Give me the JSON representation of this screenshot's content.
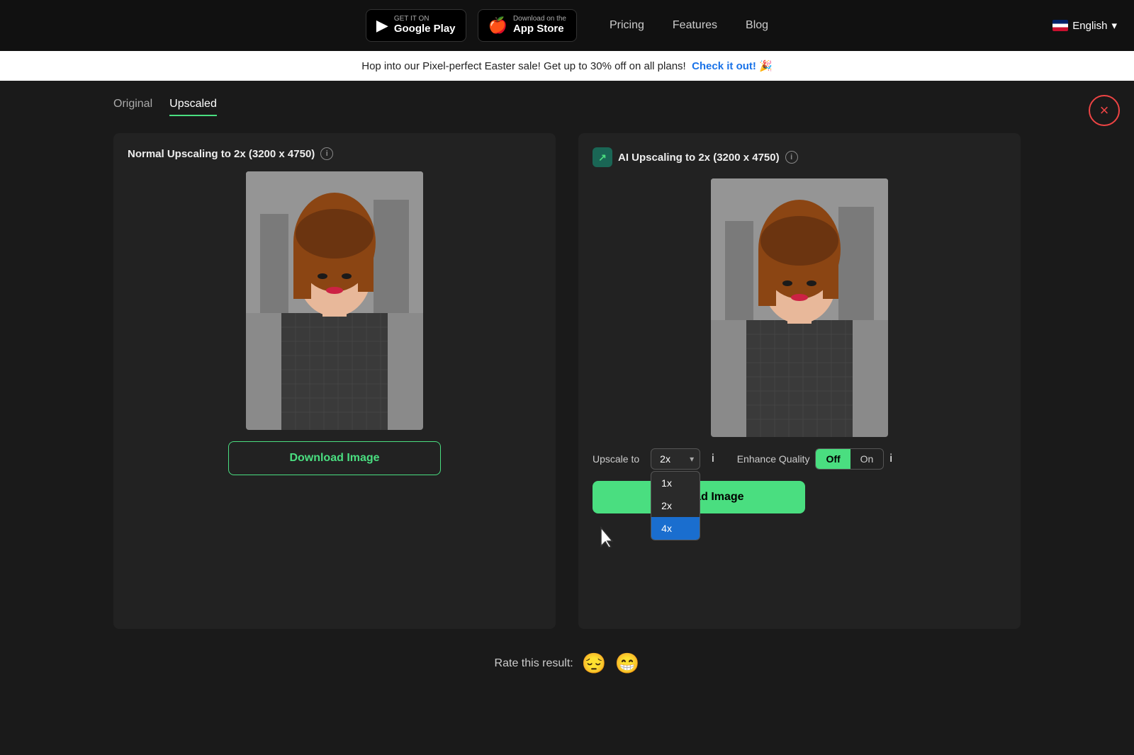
{
  "nav": {
    "google_play_top": "GET IT ON",
    "google_play_bottom": "Google Play",
    "app_store_top": "Download on the",
    "app_store_bottom": "App Store",
    "pricing": "Pricing",
    "features": "Features",
    "blog": "Blog",
    "language": "English"
  },
  "promo": {
    "text": "Hop into our Pixel-perfect Easter sale! Get up to 30% off on all plans!",
    "link_text": "Check it out!",
    "emoji": "🎉"
  },
  "tabs": [
    {
      "label": "Original",
      "active": false
    },
    {
      "label": "Upscaled",
      "active": true
    }
  ],
  "left_panel": {
    "title": "Normal Upscaling to 2x (3200 x 4750)",
    "download_label": "Download Image"
  },
  "right_panel": {
    "title": "AI Upscaling to 2x (3200 x 4750)",
    "upscale_label": "Upscale to",
    "upscale_value": "2x",
    "upscale_options": [
      "1x",
      "2x",
      "4x"
    ],
    "enhance_label": "Enhance Quality",
    "toggle_off": "Off",
    "toggle_on": "On",
    "download_label": "Download Image"
  },
  "rating": {
    "label": "Rate this result:",
    "unhappy_emoji": "😔",
    "happy_emoji": "😁"
  },
  "close_label": "×"
}
